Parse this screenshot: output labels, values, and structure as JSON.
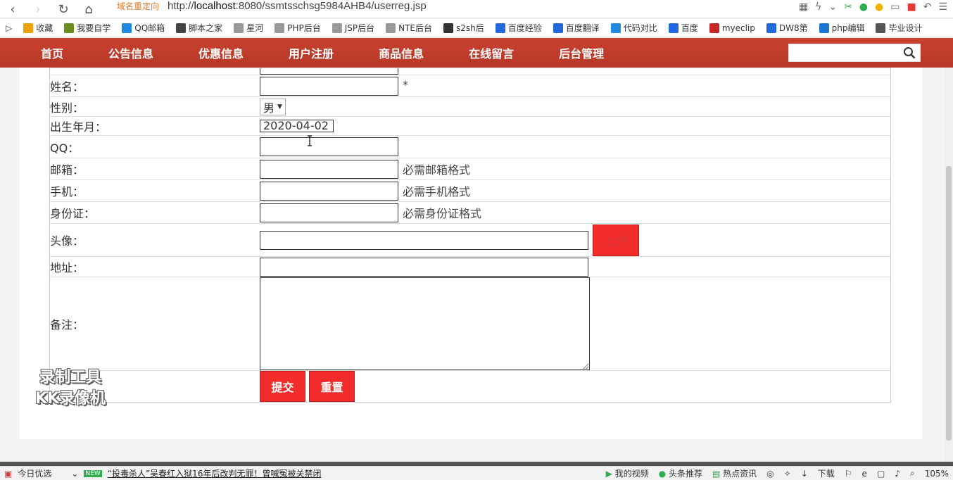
{
  "browser": {
    "redirect_tag": "域名重定向",
    "url_prefix": "http://",
    "url_host": "localhost",
    "url_rest": ":8080/ssmtsschsg5984AHB4/userreg.jsp"
  },
  "bookmarks": [
    {
      "label": "收藏",
      "icon": "star-icon",
      "color": "#f0a000"
    },
    {
      "label": "我要自学",
      "icon": "book-icon",
      "color": "#6b8e23"
    },
    {
      "label": "QQ邮箱",
      "icon": "qq-mail-icon",
      "color": "#1e88e5"
    },
    {
      "label": "脚本之家",
      "icon": "jb-icon",
      "color": "#444"
    },
    {
      "label": "星河",
      "icon": "doc-icon",
      "color": "#999"
    },
    {
      "label": "PHP后台",
      "icon": "doc-icon",
      "color": "#999"
    },
    {
      "label": "JSP后台",
      "icon": "doc-icon",
      "color": "#999"
    },
    {
      "label": "NTE后台",
      "icon": "doc-icon",
      "color": "#999"
    },
    {
      "label": "s2sh后",
      "icon": "image-icon",
      "color": "#333"
    },
    {
      "label": "百度经验",
      "icon": "baidu-paw-icon",
      "color": "#2468e0"
    },
    {
      "label": "百度翻译",
      "icon": "translate-icon",
      "color": "#2468e0"
    },
    {
      "label": "代码对比",
      "icon": "compare-icon",
      "color": "#1e88e5"
    },
    {
      "label": "百度",
      "icon": "baidu-paw-icon",
      "color": "#2468e0"
    },
    {
      "label": "myeclip",
      "icon": "c-icon",
      "color": "#c62828"
    },
    {
      "label": "DW8第",
      "icon": "baidu-paw-icon",
      "color": "#2468e0"
    },
    {
      "label": "php编辑",
      "icon": "k-icon",
      "color": "#1976d2"
    },
    {
      "label": "毕业设计",
      "icon": "globe-icon",
      "color": "#555"
    }
  ],
  "nav": {
    "items": [
      "首页",
      "公告信息",
      "优惠信息",
      "用户注册",
      "商品信息",
      "在线留言",
      "后台管理"
    ],
    "search_placeholder": ""
  },
  "form": {
    "name_label": "姓名：",
    "name_required": "*",
    "gender_label": "性别：",
    "gender_value": "男",
    "birth_label": "出生年月：",
    "birth_value": "2020-04-02",
    "qq_label": "QQ：",
    "email_label": "邮箱：",
    "email_hint": "必需邮箱格式",
    "phone_label": "手机：",
    "phone_hint": "必需手机格式",
    "idcard_label": "身份证：",
    "idcard_hint": "必需身份证格式",
    "avatar_label": "头像：",
    "upload_label": "上传",
    "address_label": "地址：",
    "note_label": "备注：",
    "submit_label": "提交",
    "reset_label": "重置"
  },
  "watermark": {
    "line1": "录制工具",
    "line2": "KK录像机"
  },
  "status_bar": {
    "today_pick": "今日优选",
    "news_badge": "NEW",
    "news": "“投毒杀人”吴春红入狱16年后改判无罪！曾喊冤被关禁闭",
    "my_video": "我的视频",
    "headline": "头条推荐",
    "hot_news": "热点资讯",
    "download": "下载",
    "zoom": "105%"
  },
  "colors": {
    "nav_bg": "#c0392b",
    "button_red": "#f22b2b"
  }
}
